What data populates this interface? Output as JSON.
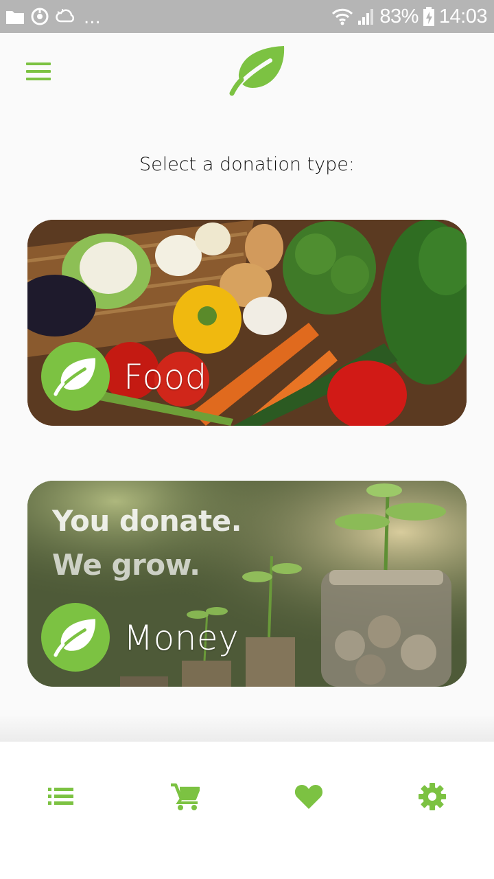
{
  "status_bar": {
    "battery": "83%",
    "time": "14:03",
    "overflow": "...",
    "icons": [
      "folder-icon",
      "sync-icon",
      "weather-icon",
      "wifi-icon",
      "signal-icon",
      "battery-icon"
    ]
  },
  "header": {
    "menu_icon": "hamburger-menu-icon",
    "logo_icon": "leaf-logo-icon"
  },
  "prompt": "Select a donation type:",
  "cards": [
    {
      "label": "Food",
      "icon": "leaf-icon"
    },
    {
      "label": "Money",
      "icon": "leaf-icon",
      "tagline": [
        "You donate.",
        "We grow."
      ]
    }
  ],
  "bottom_nav": {
    "items": [
      "list-icon",
      "cart-icon",
      "heart-icon",
      "settings-icon"
    ]
  },
  "colors": {
    "accent": "#7cc242",
    "status_bar": "#b5b5b5",
    "background": "#fafafa"
  }
}
